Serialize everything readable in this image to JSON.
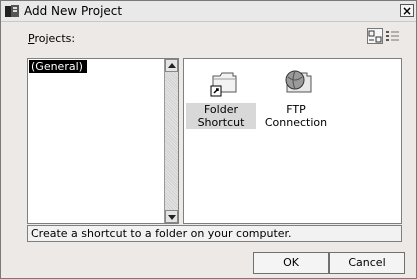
{
  "window": {
    "title": "Add New Project",
    "close_glyph": "×"
  },
  "projects": {
    "label_first": "P",
    "label_rest": "rojects:",
    "tree_items": [
      {
        "label": "(General)",
        "selected": true
      }
    ]
  },
  "view_buttons": [
    {
      "icon": "large-icons-view-icon",
      "active": true
    },
    {
      "icon": "list-view-icon",
      "active": false
    }
  ],
  "templates": [
    {
      "label": "Folder Shortcut",
      "icon": "folder-shortcut-icon",
      "selected": true
    },
    {
      "label": "FTP Connection",
      "icon": "ftp-connection-icon",
      "selected": false
    }
  ],
  "status": {
    "description": "Create a shortcut to a folder on your computer."
  },
  "buttons": {
    "ok_label": "OK",
    "cancel_label": "Cancel"
  }
}
